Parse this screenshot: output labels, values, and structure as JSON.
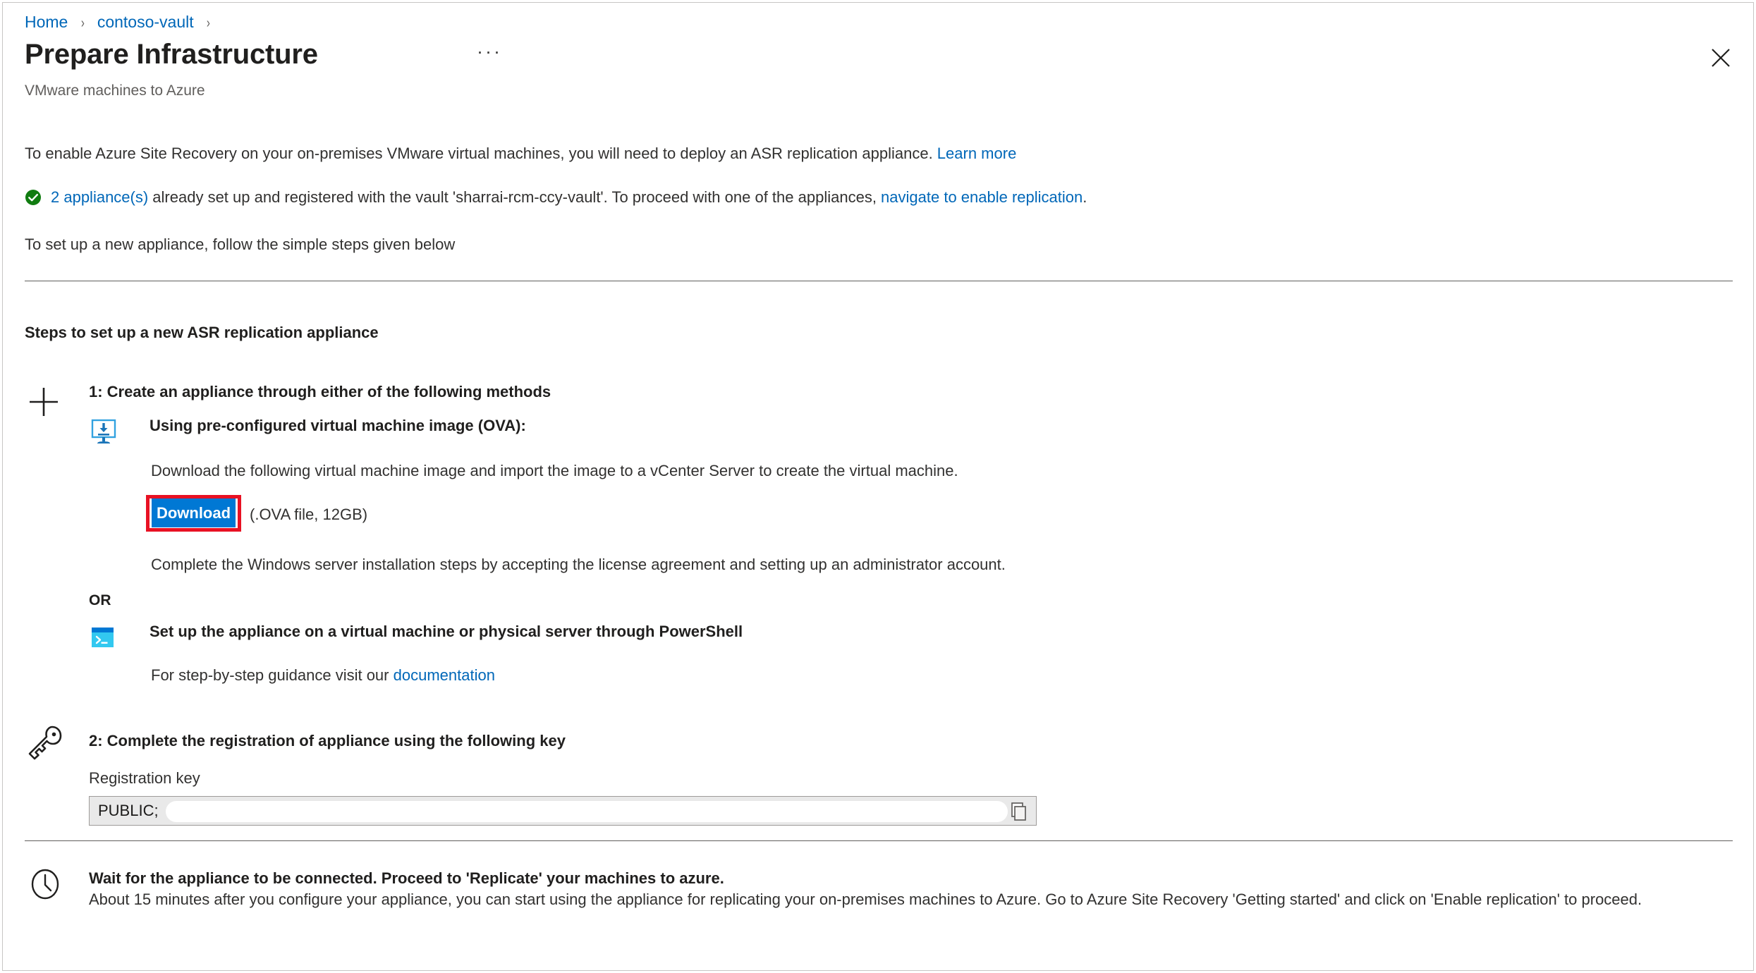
{
  "breadcrumb": {
    "items": [
      {
        "label": "Home"
      },
      {
        "label": "contoso-vault"
      }
    ],
    "separator": "›"
  },
  "header": {
    "title": "Prepare Infrastructure",
    "subtitle": "VMware machines to Azure",
    "more_label": "···",
    "close_icon": "close-icon"
  },
  "intro": {
    "line1_text": "To enable Azure Site Recovery on your on-premises VMware virtual machines, you will need to deploy an ASR replication appliance. ",
    "line1_link": "Learn more",
    "status_icon": "success-check-icon",
    "line2_link_prefix": "2 appliance(s)",
    "line2_text_mid": " already set up and registered with the vault 'sharrai-rcm-ccy-vault'. To proceed with one of the appliances, ",
    "line2_link_suffix": "navigate to enable replication",
    "line2_period": ".",
    "line3_text": "To set up a new appliance, follow the simple steps given below"
  },
  "steps": {
    "heading": "Steps to set up a new ASR replication appliance",
    "step1": {
      "icon": "plus-icon",
      "title": "1: Create an appliance through either of the following methods",
      "ova": {
        "icon": "vm-image-download-icon",
        "title": "Using pre-configured virtual machine image (OVA):",
        "description": "Download the following virtual machine image and import the image to a vCenter Server to create the virtual machine.",
        "download_button": "Download",
        "download_note": "(.OVA file, 12GB)",
        "highlight_color": "#e81123",
        "button_color": "#0078d4",
        "post_text": "Complete the Windows server installation steps by accepting the license agreement and setting up an administrator account."
      },
      "or_label": "OR",
      "powershell": {
        "icon": "powershell-terminal-icon",
        "title": "Set up the appliance on a virtual machine or physical server through PowerShell",
        "guidance_text": "For step-by-step guidance visit our ",
        "guidance_link": "documentation"
      }
    },
    "step2": {
      "icon": "key-icon",
      "title": "2: Complete the registration of appliance using the following key",
      "field_label": "Registration key",
      "field_value": "PUBLIC;",
      "field_redacted": true,
      "copy_icon": "copy-icon"
    }
  },
  "footer": {
    "icon": "clock-icon",
    "headline": "Wait for the appliance to be connected. Proceed to 'Replicate' your machines to azure.",
    "description": "About 15 minutes after you configure your appliance, you can start using the appliance for replicating your on-premises machines to Azure. Go to Azure Site Recovery 'Getting started' and click on 'Enable replication' to proceed."
  },
  "colors": {
    "link": "#0067b8",
    "accent": "#0078d4",
    "success": "#107c10",
    "highlight": "#e81123"
  }
}
